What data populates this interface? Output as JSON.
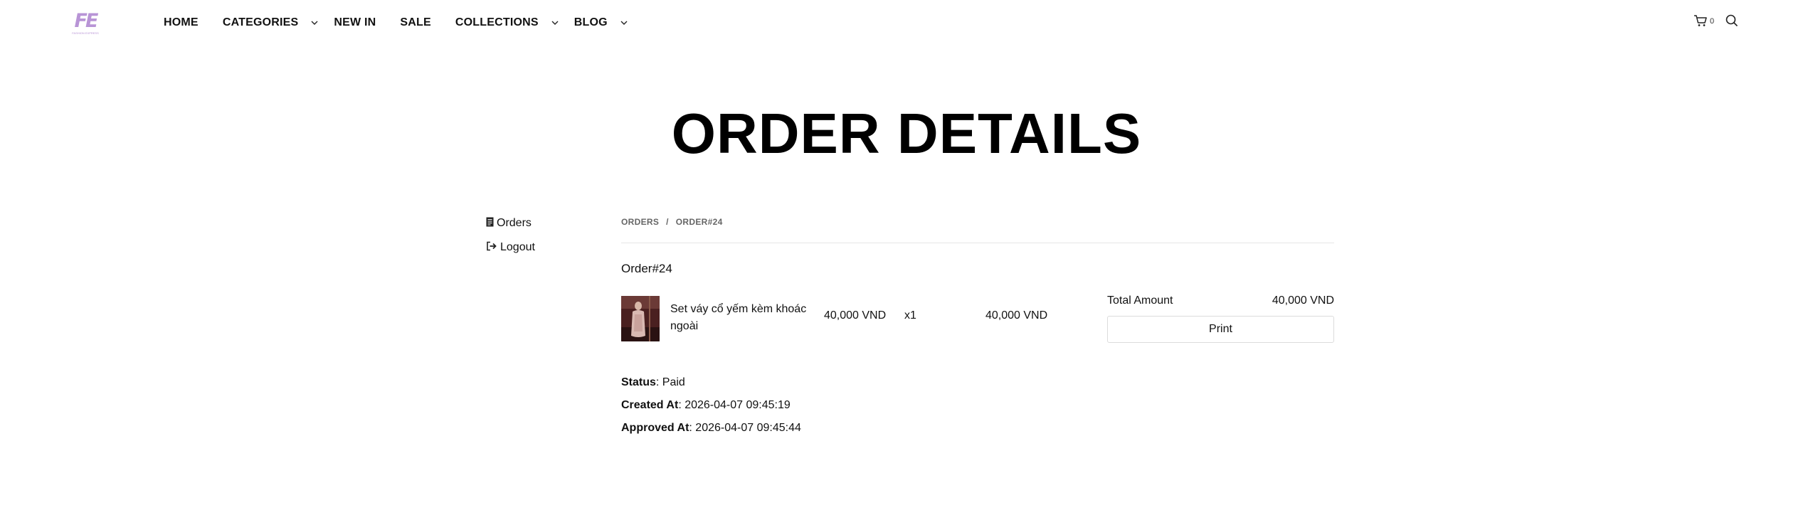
{
  "header": {
    "logo_text": "FE",
    "logo_tagline": "FASHION EXPRESS",
    "nav": [
      {
        "label": "HOME",
        "has_dropdown": false
      },
      {
        "label": "CATEGORIES",
        "has_dropdown": true
      },
      {
        "label": "NEW IN",
        "has_dropdown": false
      },
      {
        "label": "SALE",
        "has_dropdown": false
      },
      {
        "label": "COLLECTIONS",
        "has_dropdown": true
      },
      {
        "label": "BLOG",
        "has_dropdown": true
      }
    ],
    "cart_icon": "cart-icon",
    "cart_count": "0",
    "search_icon": "search-icon"
  },
  "page_title": "ORDER DETAILS",
  "sidebar": {
    "items": [
      {
        "label": "Orders",
        "icon": "document-icon"
      },
      {
        "label": "Logout",
        "icon": "logout-icon"
      }
    ]
  },
  "breadcrumb": {
    "items": [
      "ORDERS",
      "ORDER#24"
    ],
    "separator": "/"
  },
  "order": {
    "id_label": "Order#24",
    "item": {
      "name": "Set váy cổ yếm kèm khoác ngoài",
      "price": "40,000 VND",
      "quantity": "x1",
      "total": "40,000 VND"
    },
    "summary": {
      "total_label": "Total Amount",
      "total_value": "40,000 VND",
      "print_label": "Print"
    },
    "meta": {
      "status_label": "Status",
      "status_value": ": Paid",
      "created_label": "Created At",
      "created_value": ": 2026-04-07 09:45:19",
      "approved_label": "Approved At",
      "approved_value": ": 2026-04-07 09:45:44"
    }
  },
  "colors": {
    "logo": "#b894d6",
    "text": "#111111",
    "muted": "#666666",
    "divider": "#e6e6e6"
  }
}
